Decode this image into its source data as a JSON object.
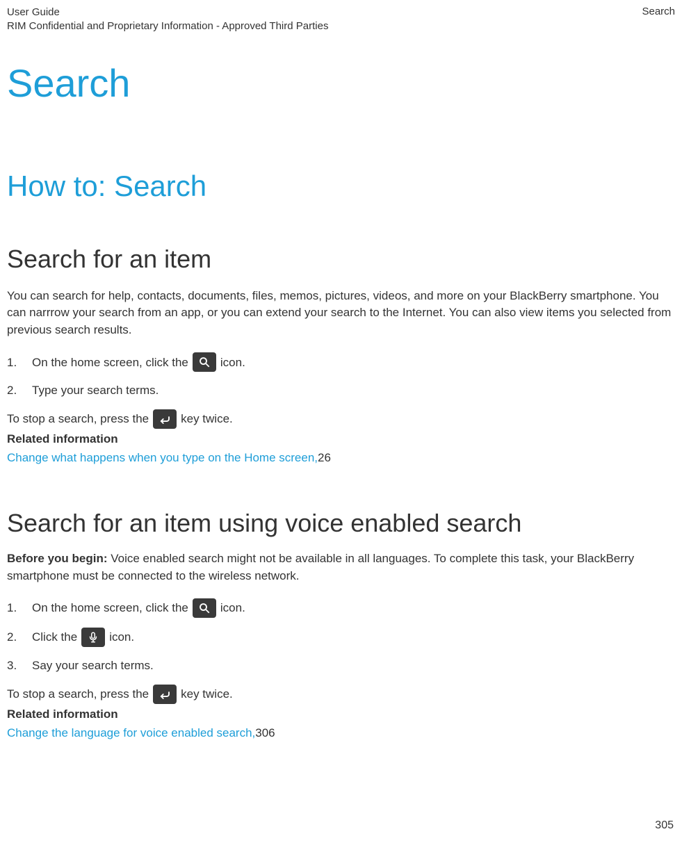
{
  "header": {
    "left_line1": "User Guide",
    "left_line2": "RIM Confidential and Proprietary Information - Approved Third Parties",
    "right": "Search"
  },
  "title": "Search",
  "section": "How to: Search",
  "s1": {
    "heading": "Search for an item",
    "intro": "You can search for help, contacts, documents, files, memos, pictures, videos, and more on your BlackBerry smartphone. You can narrrow your search from an app, or you can extend your search to the Internet. You can also view items you selected from previous search results.",
    "step1_a": "On the home screen, click the ",
    "step1_b": " icon.",
    "step2": "Type your search terms.",
    "stop_a": "To stop a search, press the ",
    "stop_b": " key twice.",
    "related_label": "Related information",
    "link_text": "Change what happens when you type on the Home screen,",
    "link_page": " 26"
  },
  "s2": {
    "heading": "Search for an item using voice enabled search",
    "before_label": "Before you begin:",
    "before_text": " Voice enabled search might not be available in all languages. To complete this task, your BlackBerry smartphone must be connected to the wireless network.",
    "step1_a": "On the home screen, click the ",
    "step1_b": " icon.",
    "step2_a": "Click the ",
    "step2_b": " icon.",
    "step3": "Say your search terms.",
    "stop_a": "To stop a search, press the ",
    "stop_b": " key twice.",
    "related_label": "Related information",
    "link_text": "Change the language for voice enabled search,",
    "link_page": " 306"
  },
  "page_number": "305"
}
